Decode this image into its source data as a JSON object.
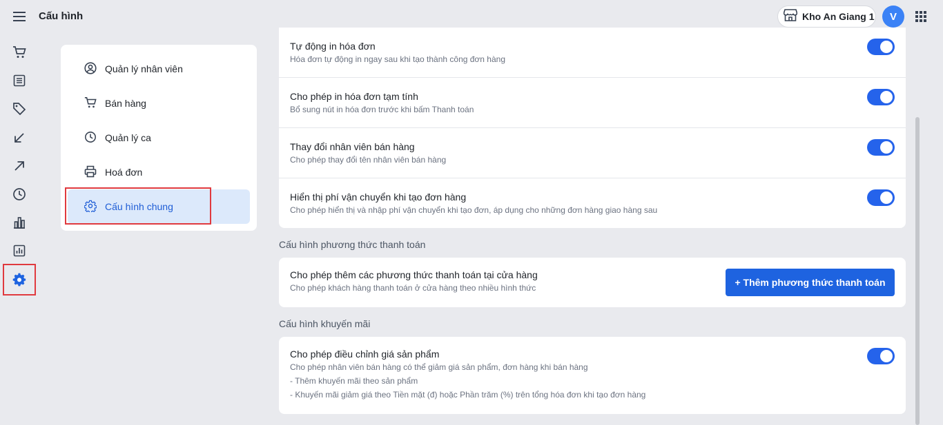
{
  "header": {
    "title": "Cấu hình",
    "store": "Kho An Giang 1",
    "avatar_letter": "V"
  },
  "rail": {
    "items": [
      "cart-icon",
      "list-icon",
      "tag-icon",
      "arrow-down-left-icon",
      "arrow-up-right-icon",
      "clock-icon",
      "bar-chart-icon",
      "report-icon",
      "gear-icon"
    ],
    "active": "gear-icon"
  },
  "settings_menu": {
    "items": [
      {
        "label": "Quản lý nhân viên",
        "icon": "user-circle-icon"
      },
      {
        "label": "Bán hàng",
        "icon": "cart-icon"
      },
      {
        "label": "Quản lý ca",
        "icon": "clock-icon"
      },
      {
        "label": "Hoá đơn",
        "icon": "printer-icon"
      },
      {
        "label": "Cấu hình chung",
        "icon": "gear-icon"
      }
    ],
    "active": "Cấu hình chung"
  },
  "invoice_settings": [
    {
      "title": "Tự động in hóa đơn",
      "desc": "Hóa đơn tự động in ngay sau khi tạo thành công đơn hàng",
      "enabled": true
    },
    {
      "title": "Cho phép in hóa đơn tạm tính",
      "desc": "Bổ sung nút in hóa đơn trước khi bấm Thanh toán",
      "enabled": true
    },
    {
      "title": "Thay đổi nhân viên bán hàng",
      "desc": "Cho phép thay đổi tên nhân viên bán hàng",
      "enabled": true
    },
    {
      "title": "Hiển thị phí vận chuyển khi tạo đơn hàng",
      "desc": "Cho phép hiển thị và nhập phí vận chuyển khi tạo đơn, áp dụng cho những đơn hàng giao hàng sau",
      "enabled": true
    }
  ],
  "payment_section": {
    "title": "Cấu hình phương thức thanh toán",
    "row_title": "Cho phép thêm các phương thức thanh toán tại cửa hàng",
    "row_desc": "Cho phép khách hàng thanh toán ở cửa hàng theo nhiều hình thức",
    "button": "+ Thêm phương thức thanh toán"
  },
  "promo_section": {
    "title": "Cấu hình khuyến mãi",
    "row_title": "Cho phép điều chỉnh giá sản phẩm",
    "desc_lines": [
      "Cho phép nhân viên bán hàng có thể giảm giá sản phẩm, đơn hàng khi bán hàng",
      "- Thêm khuyến mãi theo sản phẩm",
      "- Khuyến mãi giảm giá theo Tiền mặt (đ) hoặc Phần trăm (%) trên tổng hóa đơn khi tạo đơn hàng"
    ],
    "enabled": true
  },
  "colors": {
    "accent": "#1e63e0",
    "toggle_on": "#2563eb",
    "highlight": "#e0393e",
    "active_bg": "#dce9fb"
  }
}
